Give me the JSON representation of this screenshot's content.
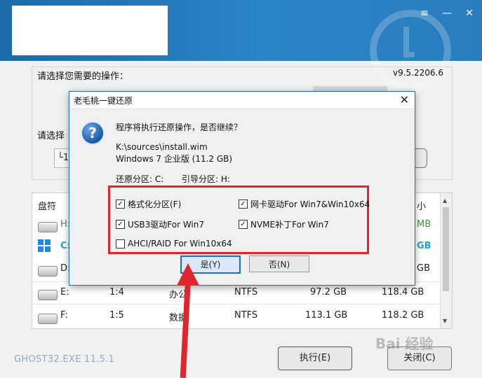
{
  "app": {
    "operation_label": "请选择您需要的操作：",
    "version": "v9.5.2206.6",
    "select_label": "请选择",
    "path_prefix": "└1",
    "menu_icon": "≡",
    "minimize_icon": "—",
    "close_icon": "✕"
  },
  "table": {
    "header_disk": "盘符",
    "header_size": "小",
    "rows": [
      {
        "drive": "H:",
        "num": "",
        "label": "",
        "fs": "",
        "free": "",
        "total": "MB",
        "style": "green"
      },
      {
        "drive": "C:",
        "num": "",
        "label": "",
        "fs": "",
        "free": "",
        "total": "GB",
        "style": "cyan"
      },
      {
        "drive": "D:",
        "num": "",
        "label": "",
        "fs": "",
        "free": "",
        "total": "GB",
        "style": "normal"
      },
      {
        "drive": "E:",
        "num": "1:4",
        "label": "办公",
        "fs": "NTFS",
        "free": "97.2 GB",
        "total": "118.4 GB",
        "style": "normal"
      },
      {
        "drive": "F:",
        "num": "1:5",
        "label": "数据",
        "fs": "NTFS",
        "free": "113.1 GB",
        "total": "118.2 GB",
        "style": "normal"
      }
    ]
  },
  "footer": {
    "ghost_version": "GHOST32.EXE 11.5.1",
    "execute_label": "执行(E)",
    "close_label": "关闭(C)",
    "watermark": "Bai 经验"
  },
  "dialog": {
    "title": "老毛桃一键还原",
    "close_icon": "✕",
    "question_icon": "?",
    "message": "程序将执行还原操作，是否继续？",
    "source_path": "K:\\sources\\install.wim",
    "os_version": "Windows 7 企业版 (11.2 GB)",
    "restore_partition": "还原分区: C:",
    "boot_partition": "引导分区: H:",
    "options": [
      {
        "label": "格式化分区(F)",
        "checked": true
      },
      {
        "label": "网卡驱动For Win7&Win10x64",
        "checked": true
      },
      {
        "label": "USB3驱动For Win7",
        "checked": true
      },
      {
        "label": "NVME补丁For Win7",
        "checked": true
      },
      {
        "label": "AHCI/RAID For Win10x64",
        "checked": false
      }
    ],
    "yes_label": "是(Y)",
    "no_label": "否(N)"
  },
  "colors": {
    "accent_red": "#e0252c",
    "header_blue": "#2b84c8"
  }
}
